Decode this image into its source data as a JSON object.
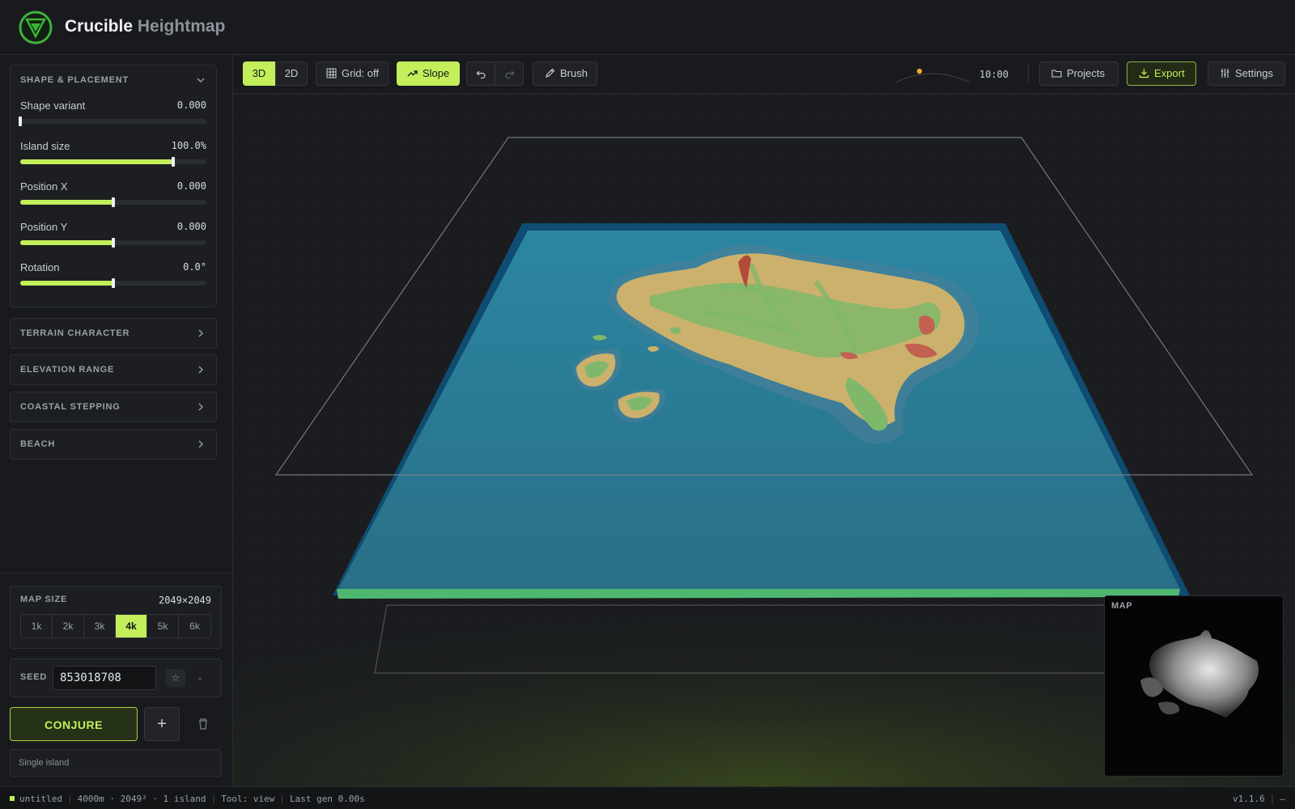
{
  "header": {
    "title": "Crucible",
    "subtitle": "Heightmap"
  },
  "sidebar": {
    "shape_section": {
      "title": "SHAPE & PLACEMENT",
      "sliders": [
        {
          "label": "Shape variant",
          "value": "0.000",
          "fraction": 0.0
        },
        {
          "label": "Island size",
          "value": "100.0%",
          "fraction": 0.82
        },
        {
          "label": "Position X",
          "value": "0.000",
          "fraction": 0.5
        },
        {
          "label": "Position Y",
          "value": "0.000",
          "fraction": 0.5
        },
        {
          "label": "Rotation",
          "value": "0.0°",
          "fraction": 0.5
        }
      ]
    },
    "collapsed_sections": [
      {
        "title": "TERRAIN CHARACTER"
      },
      {
        "title": "ELEVATION RANGE"
      },
      {
        "title": "COASTAL STEPPING"
      },
      {
        "title": "BEACH"
      }
    ],
    "map_size": {
      "label": "MAP SIZE",
      "value": "2049×2049",
      "options": [
        "1k",
        "2k",
        "3k",
        "4k",
        "5k",
        "6k"
      ],
      "selected": "4k"
    },
    "seed": {
      "label": "SEED",
      "value": "853018708",
      "star": "☆",
      "minus": "-"
    },
    "conjure_label": "CONJURE",
    "add_label": "+",
    "mode_label": "Single island"
  },
  "toolbar": {
    "view_3d": "3D",
    "view_2d": "2D",
    "grid_label": "Grid: off",
    "slope_label": "Slope",
    "brush_label": "Brush",
    "time": "10:00",
    "projects_label": "Projects",
    "export_label": "Export",
    "settings_label": "Settings"
  },
  "minimap": {
    "label": "MAP"
  },
  "status": {
    "file": "untitled",
    "dims": "4000m · 2049² · 1 island",
    "tool": "Tool: view",
    "last_gen": "Last gen 0.00s",
    "version": "v1.1.6",
    "dash": "—"
  },
  "colors": {
    "accent": "#c3ef5a",
    "water": "#2d7c97",
    "land_green": "#7fb86a",
    "land_tan": "#cbb16c",
    "land_red": "#c26150"
  }
}
